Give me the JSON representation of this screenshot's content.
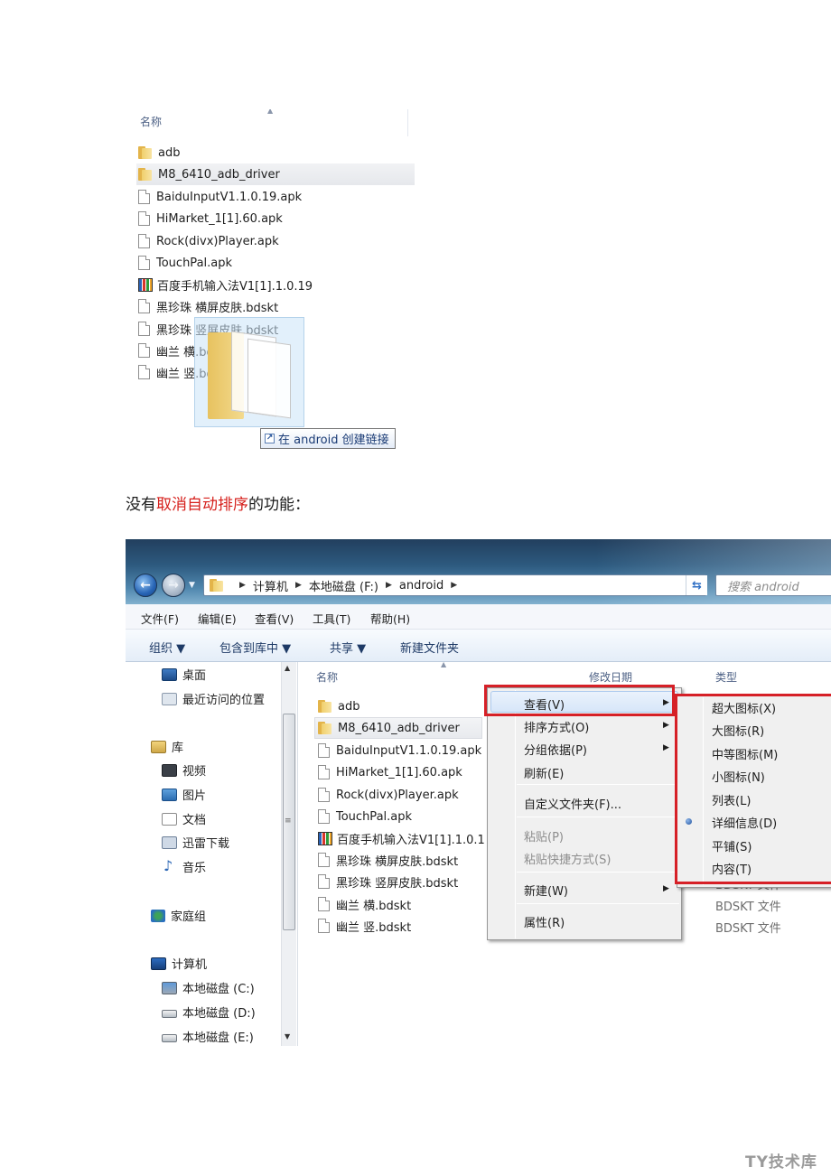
{
  "figure1": {
    "column_header": "名称",
    "rows": [
      {
        "name": "adb",
        "icon": "folder-icon"
      },
      {
        "name": "M8_6410_adb_driver",
        "icon": "folder-icon",
        "selected": true
      },
      {
        "name": "BaiduInputV1.1.0.19.apk",
        "icon": "file-icon"
      },
      {
        "name": "HiMarket_1[1].60.apk",
        "icon": "file-icon"
      },
      {
        "name": "Rock(divx)Player.apk",
        "icon": "file-icon"
      },
      {
        "name": "TouchPal.apk",
        "icon": "file-icon"
      },
      {
        "name": "百度手机输入法V1[1].1.0.19",
        "icon": "app-icon"
      },
      {
        "name": "黑珍珠 横屏皮肤.bdskt",
        "icon": "file-icon"
      },
      {
        "name": "黑珍珠 竖屏皮肤.bdskt",
        "icon": "file-icon"
      },
      {
        "name": "幽兰 横.bdskt",
        "icon": "file-icon"
      },
      {
        "name": "幽兰 竖.bdskt",
        "icon": "file-icon"
      }
    ],
    "drag_tooltip": "在 android 创建链接"
  },
  "caption": {
    "before": "没有",
    "highlight": "取消自动排序",
    "after": "的功能：",
    "highlight_color": "#d6201c"
  },
  "figure2": {
    "address": {
      "crumbs": [
        "计算机",
        "本地磁盘 (F:)",
        "android"
      ],
      "search_placeholder": "搜索 android"
    },
    "menubar": [
      "文件(F)",
      "编辑(E)",
      "查看(V)",
      "工具(T)",
      "帮助(H)"
    ],
    "commandbar": [
      "组织 ▼",
      "包含到库中 ▼",
      "共享 ▼",
      "新建文件夹"
    ],
    "navpane": [
      {
        "label": "桌面",
        "icon": "desktop-icon"
      },
      {
        "label": "最近访问的位置",
        "icon": "recent-places-icon"
      },
      {
        "label": "库",
        "icon": "library-icon"
      },
      {
        "label": "视频",
        "icon": "video-icon"
      },
      {
        "label": "图片",
        "icon": "pictures-icon"
      },
      {
        "label": "文档",
        "icon": "documents-icon"
      },
      {
        "label": "迅雷下载",
        "icon": "download-folder-icon"
      },
      {
        "label": "音乐",
        "icon": "music-icon"
      },
      {
        "label": "家庭组",
        "icon": "homegroup-icon"
      },
      {
        "label": "计算机",
        "icon": "computer-icon"
      },
      {
        "label": "本地磁盘 (C:)",
        "icon": "system-drive-icon"
      },
      {
        "label": "本地磁盘 (D:)",
        "icon": "drive-icon"
      },
      {
        "label": "本地磁盘 (E:)",
        "icon": "drive-icon"
      }
    ],
    "columns": {
      "name": "名称",
      "modified": "修改日期",
      "type": "类型"
    },
    "files": [
      {
        "name": "adb",
        "icon": "folder-icon"
      },
      {
        "name": "M8_6410_adb_driver",
        "icon": "folder-icon",
        "selected": true
      },
      {
        "name": "BaiduInputV1.1.0.19.apk",
        "icon": "file-icon"
      },
      {
        "name": "HiMarket_1[1].60.apk",
        "icon": "file-icon"
      },
      {
        "name": "Rock(divx)Player.apk",
        "icon": "file-icon"
      },
      {
        "name": "TouchPal.apk",
        "icon": "file-icon"
      },
      {
        "name": "百度手机输入法V1[1].1.0.1",
        "icon": "app-icon"
      },
      {
        "name": "黑珍珠 横屏皮肤.bdskt",
        "icon": "file-icon"
      },
      {
        "name": "黑珍珠 竖屏皮肤.bdskt",
        "icon": "file-icon"
      },
      {
        "name": "幽兰 横.bdskt",
        "icon": "file-icon"
      },
      {
        "name": "幽兰 竖.bdskt",
        "icon": "file-icon"
      }
    ],
    "file_types": [
      "BDSKT 文件",
      "BDSKT 文件",
      "BDSKT 文件"
    ],
    "context_menu": [
      {
        "label": "查看(V)",
        "submenu": true,
        "highlighted": true
      },
      {
        "label": "排序方式(O)",
        "submenu": true
      },
      {
        "label": "分组依据(P)",
        "submenu": true
      },
      {
        "label": "刷新(E)"
      },
      {
        "label": "自定义文件夹(F)..."
      },
      {
        "label": "粘贴(P)",
        "disabled": true
      },
      {
        "label": "粘贴快捷方式(S)",
        "disabled": true
      },
      {
        "label": "新建(W)",
        "submenu": true
      },
      {
        "label": "属性(R)"
      }
    ],
    "view_submenu": [
      {
        "label": "超大图标(X)"
      },
      {
        "label": "大图标(R)"
      },
      {
        "label": "中等图标(M)"
      },
      {
        "label": "小图标(N)"
      },
      {
        "label": "列表(L)"
      },
      {
        "label": "详细信息(D)",
        "checked": true
      },
      {
        "label": "平铺(S)"
      },
      {
        "label": "内容(T)"
      }
    ],
    "annotation_color": "#d62027"
  },
  "watermark": "TY技术库"
}
